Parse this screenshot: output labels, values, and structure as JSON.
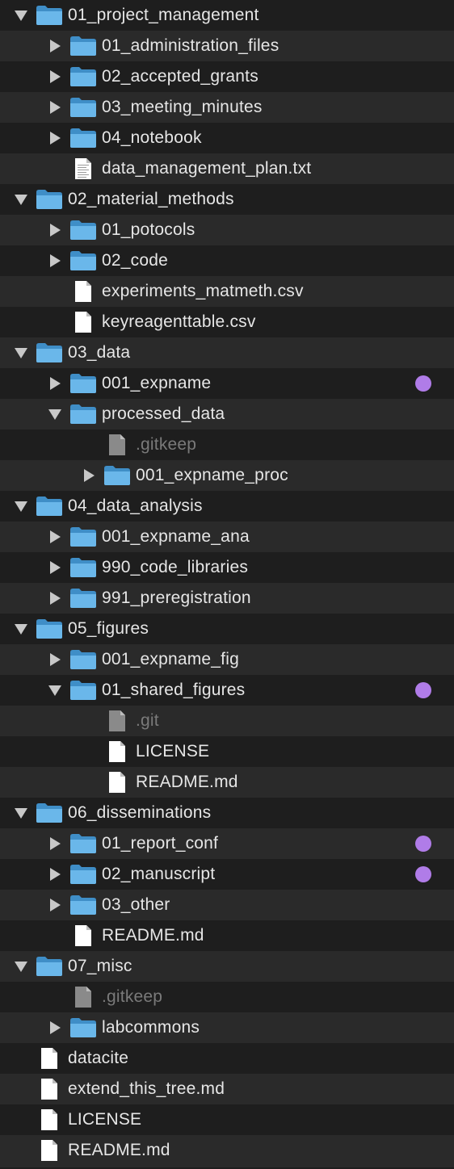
{
  "tag_color": "#b07ce8",
  "rows": [
    {
      "name": "01_project_management",
      "kind": "folder",
      "expanded": true,
      "level": 0
    },
    {
      "name": "01_administration_files",
      "kind": "folder",
      "expanded": false,
      "level": 1
    },
    {
      "name": "02_accepted_grants",
      "kind": "folder",
      "expanded": false,
      "level": 1
    },
    {
      "name": "03_meeting_minutes",
      "kind": "folder",
      "expanded": false,
      "level": 1
    },
    {
      "name": "04_notebook",
      "kind": "folder",
      "expanded": false,
      "level": 1
    },
    {
      "name": "data_management_plan.txt",
      "kind": "textfile",
      "level": 1
    },
    {
      "name": "02_material_methods",
      "kind": "folder",
      "expanded": true,
      "level": 0
    },
    {
      "name": "01_potocols",
      "kind": "folder",
      "expanded": false,
      "level": 1
    },
    {
      "name": "02_code",
      "kind": "folder",
      "expanded": false,
      "level": 1
    },
    {
      "name": "experiments_matmeth.csv",
      "kind": "file",
      "level": 1
    },
    {
      "name": "keyreagenttable.csv",
      "kind": "file",
      "level": 1
    },
    {
      "name": "03_data",
      "kind": "folder",
      "expanded": true,
      "level": 0
    },
    {
      "name": "001_expname",
      "kind": "folder",
      "expanded": false,
      "level": 1,
      "tag": true
    },
    {
      "name": "processed_data",
      "kind": "folder",
      "expanded": true,
      "level": 1
    },
    {
      "name": ".gitkeep",
      "kind": "hiddenfile",
      "level": 2
    },
    {
      "name": "001_expname_proc",
      "kind": "folder",
      "expanded": false,
      "level": 2
    },
    {
      "name": "04_data_analysis",
      "kind": "folder",
      "expanded": true,
      "level": 0
    },
    {
      "name": "001_expname_ana",
      "kind": "folder",
      "expanded": false,
      "level": 1
    },
    {
      "name": "990_code_libraries",
      "kind": "folder",
      "expanded": false,
      "level": 1
    },
    {
      "name": "991_preregistration",
      "kind": "folder",
      "expanded": false,
      "level": 1
    },
    {
      "name": "05_figures",
      "kind": "folder",
      "expanded": true,
      "level": 0
    },
    {
      "name": "001_expname_fig",
      "kind": "folder",
      "expanded": false,
      "level": 1
    },
    {
      "name": "01_shared_figures",
      "kind": "folder",
      "expanded": true,
      "level": 1,
      "tag": true
    },
    {
      "name": ".git",
      "kind": "hiddenfile",
      "level": 2
    },
    {
      "name": "LICENSE",
      "kind": "file",
      "level": 2
    },
    {
      "name": "README.md",
      "kind": "file",
      "level": 2
    },
    {
      "name": "06_disseminations",
      "kind": "folder",
      "expanded": true,
      "level": 0
    },
    {
      "name": "01_report_conf",
      "kind": "folder",
      "expanded": false,
      "level": 1,
      "tag": true
    },
    {
      "name": "02_manuscript",
      "kind": "folder",
      "expanded": false,
      "level": 1,
      "tag": true
    },
    {
      "name": "03_other",
      "kind": "folder",
      "expanded": false,
      "level": 1
    },
    {
      "name": "README.md",
      "kind": "file",
      "level": 1
    },
    {
      "name": "07_misc",
      "kind": "folder",
      "expanded": true,
      "level": 0
    },
    {
      "name": ".gitkeep",
      "kind": "hiddenfile",
      "level": 1
    },
    {
      "name": "labcommons",
      "kind": "folder",
      "expanded": false,
      "level": 1
    },
    {
      "name": "datacite",
      "kind": "file",
      "level": 0
    },
    {
      "name": "extend_this_tree.md",
      "kind": "file",
      "level": 0
    },
    {
      "name": "LICENSE",
      "kind": "file",
      "level": 0
    },
    {
      "name": "README.md",
      "kind": "file",
      "level": 0
    }
  ]
}
